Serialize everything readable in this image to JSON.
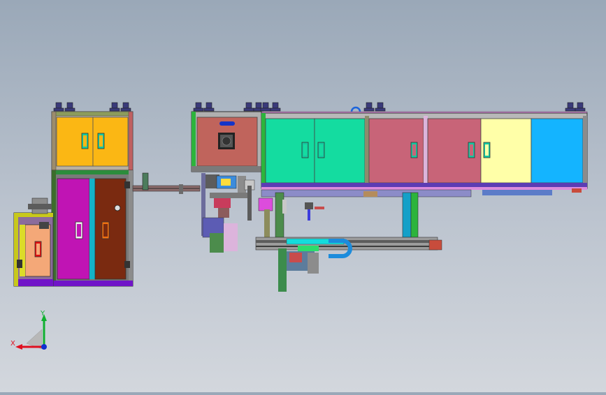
{
  "viewport": {
    "background_top": "#9aa8b8",
    "background_bottom": "#d3d7dd"
  },
  "triad": {
    "x_label": "X",
    "y_label": "Y",
    "x_color": "#e01020",
    "y_color": "#10b030",
    "z_color": "#1030d0"
  },
  "palette": {
    "yellow_panel": "#fbb714",
    "magenta_panel": "#c014b4",
    "brown_panel": "#7a2a10",
    "salmon_panel": "#f4a878",
    "red_panel": "#c0645c",
    "teal_panel": "#14dca0",
    "rose_panel": "#c86478",
    "pale_yellow_panel": "#ffffa8",
    "cyan_panel": "#14b4ff",
    "frame_green": "#4c8c3c",
    "frame_purple": "#7014c8",
    "frame_gray": "#6c6c6c"
  }
}
